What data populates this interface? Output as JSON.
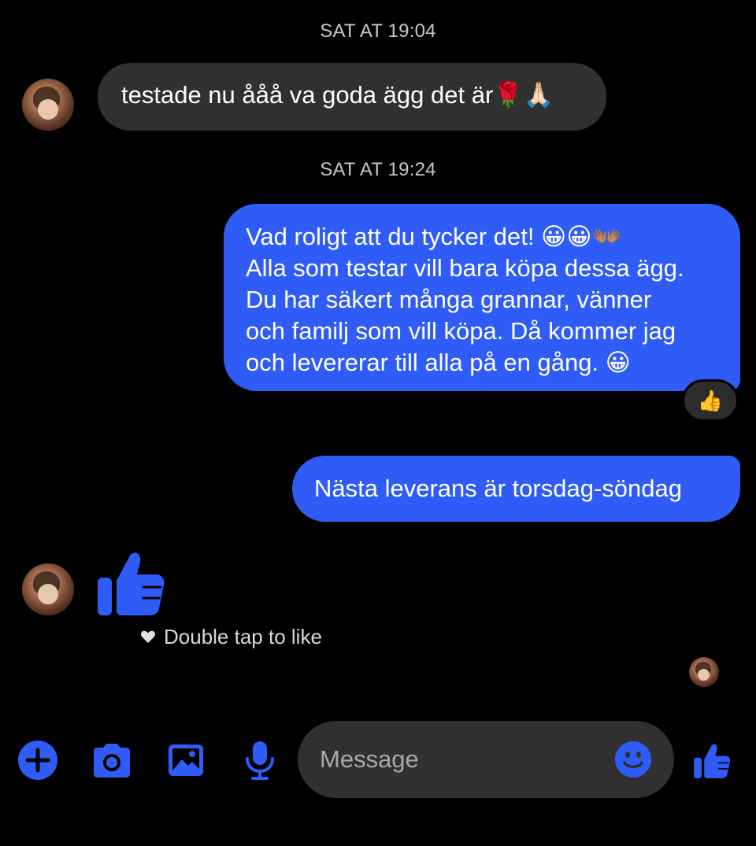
{
  "thread": {
    "timestamp_1": "SAT AT 19:04",
    "timestamp_2": "SAT AT 19:24",
    "messages": [
      {
        "direction": "incoming",
        "text": "testade nu ååå va goda ägg det är🌹🙏🏻"
      },
      {
        "direction": "outgoing",
        "lines": [
          "Vad roligt att du tycker det! 😀😀👐🏽",
          "Alla som testar vill bara köpa dessa ägg.",
          "Du har säkert många grannar, vänner",
          "och familj som vill köpa. Då kommer jag",
          "och levererar till alla på en gång. 😀"
        ],
        "reaction": "👍"
      },
      {
        "direction": "outgoing",
        "text": "Nästa leverans är torsdag-söndag"
      },
      {
        "direction": "incoming",
        "type": "like-sticker",
        "hint": "Double tap to like"
      }
    ]
  },
  "composer": {
    "placeholder": "Message",
    "icons": [
      "plus-icon",
      "camera-icon",
      "image-icon",
      "microphone-icon",
      "emoji-icon",
      "thumbs-up-icon"
    ]
  },
  "colors": {
    "accent": "#2f5cf6",
    "incoming_bubble": "#303030",
    "background": "#000000"
  }
}
